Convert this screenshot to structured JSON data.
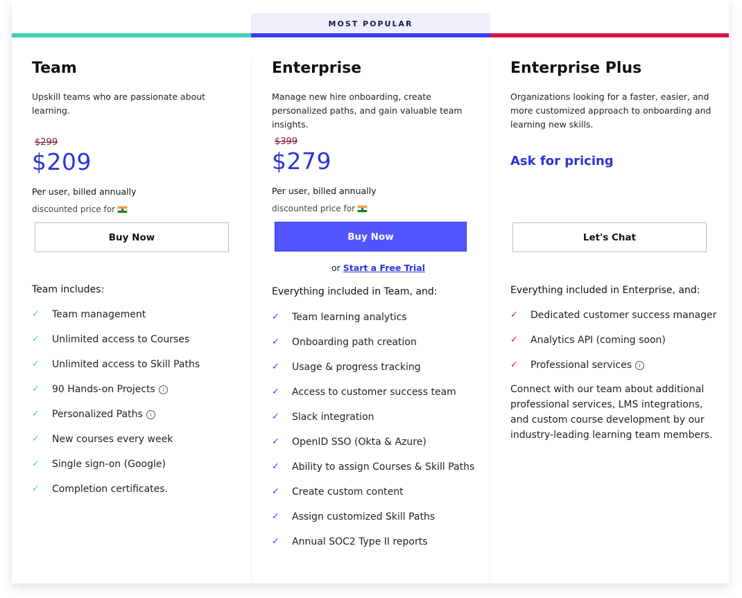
{
  "badge": "MOST POPULAR",
  "colors": {
    "team": "#3fd1b4",
    "enterprise": "#3a3df2",
    "enterprise_plus": "#d3174b",
    "price": "#2b34d8",
    "primary_button": "#5255ff"
  },
  "plans": [
    {
      "name": "Team",
      "description": "Upskill teams who are passionate about learning.",
      "old_price": "$299",
      "price": "$209",
      "billing": "Per user, billed annually",
      "discount": "discounted price for",
      "button": "Buy Now",
      "includes_title": "Team includes:",
      "features": [
        {
          "text": "Team management",
          "info": false
        },
        {
          "text": "Unlimited access to Courses",
          "info": false
        },
        {
          "text": "Unlimited access to Skill Paths",
          "info": false
        },
        {
          "text": "90 Hands-on Projects",
          "info": true
        },
        {
          "text": "Personalized Paths",
          "info": true
        },
        {
          "text": "New courses every week",
          "info": false
        },
        {
          "text": "Single sign-on (Google)",
          "info": false
        },
        {
          "text": "Completion certificates.",
          "info": false
        }
      ]
    },
    {
      "name": "Enterprise",
      "description": "Manage new hire onboarding, create personalized paths, and gain valuable team insights.",
      "old_price": "$399",
      "price": "$279",
      "billing": "Per user, billed annually",
      "discount": "discounted price for",
      "button": "Buy Now",
      "trial_prefix": "or",
      "trial_link": "Start a Free Trial",
      "includes_title": "Everything included in Team, and:",
      "features": [
        {
          "text": "Team learning analytics",
          "info": false
        },
        {
          "text": "Onboarding path creation",
          "info": false
        },
        {
          "text": "Usage & progress tracking",
          "info": false
        },
        {
          "text": "Access to customer success team",
          "info": false
        },
        {
          "text": "Slack integration",
          "info": false
        },
        {
          "text": "OpenID SSO (Okta & Azure)",
          "info": false
        },
        {
          "text": "Ability to assign Courses & Skill Paths",
          "info": false
        },
        {
          "text": "Create custom content",
          "info": false
        },
        {
          "text": "Assign customized Skill Paths",
          "info": false
        },
        {
          "text": "Annual SOC2 Type II reports",
          "info": false
        }
      ]
    },
    {
      "name": "Enterprise Plus",
      "description": "Organizations looking for a faster, easier, and more customized approach to onboarding and learning new skills.",
      "price_text": "Ask for pricing",
      "button": "Let's Chat",
      "includes_title": "Everything included in Enterprise, and:",
      "features": [
        {
          "text": "Dedicated customer success manager",
          "info": false
        },
        {
          "text": "Analytics API (coming soon)",
          "info": false
        },
        {
          "text": "Professional services",
          "info": true
        }
      ],
      "extra": "Connect with our team about additional professional services, LMS integrations, and custom course development by our industry-leading learning team members."
    }
  ]
}
